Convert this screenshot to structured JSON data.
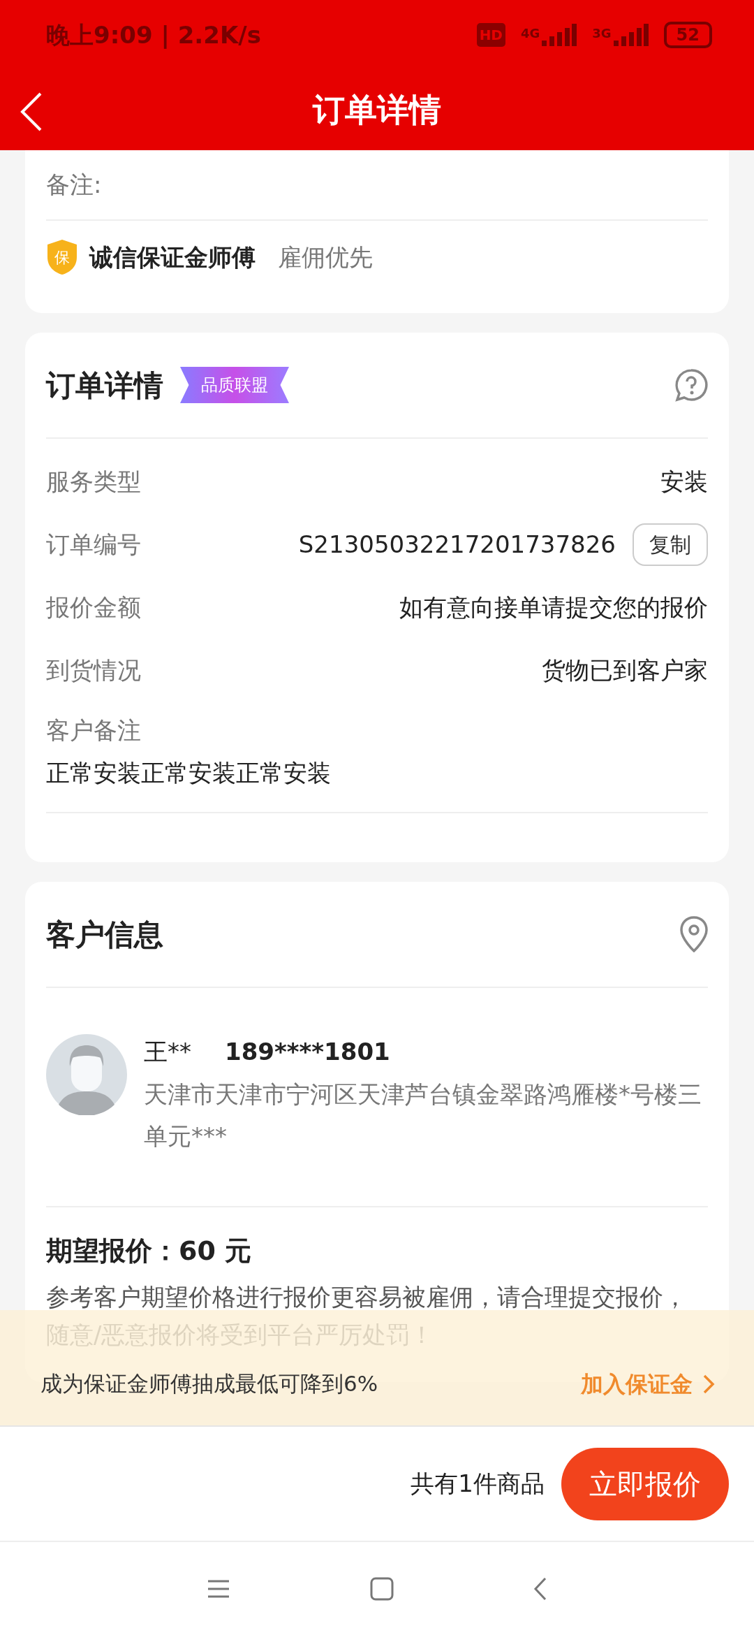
{
  "status_bar": {
    "time_speed": "晚上9:09 | 2.2K/s",
    "hd": "HD",
    "net_1": "4G",
    "net_2": "3G",
    "battery": "52"
  },
  "header": {
    "title": "订单详情"
  },
  "remark": {
    "label": "备注:"
  },
  "guarantee": {
    "badge": "保",
    "title": "诚信保证金师傅",
    "subtitle": "雇佣优先"
  },
  "order": {
    "title": "订单详情",
    "tag": "品质联盟",
    "rows": [
      {
        "label": "服务类型",
        "value": "安装"
      },
      {
        "label": "订单编号",
        "value": "S21305032217201737826",
        "action": "复制"
      },
      {
        "label": "报价金额",
        "value": "如有意向接单请提交您的报价"
      },
      {
        "label": "到货情况",
        "value": "货物已到客户家"
      }
    ],
    "note_label": "客户备注",
    "note": "正常安装正常安装正常安装"
  },
  "customer": {
    "title": "客户信息",
    "name": "王**",
    "phone": "189****1801",
    "address": "天津市天津市宁河区天津芦台镇金翠路鸿雁楼*号楼三单元***",
    "expected": "期望报价：60 元",
    "tip": "参考客户期望价格进行报价更容易被雇佣，请合理提交报价，随意/恶意报价将受到平台严厉处罚！"
  },
  "banner": {
    "text": "成为保证金师傅抽成最低可降到6%",
    "link": "加入保证金"
  },
  "footer": {
    "count": "共有1件商品",
    "button": "立即报价"
  }
}
